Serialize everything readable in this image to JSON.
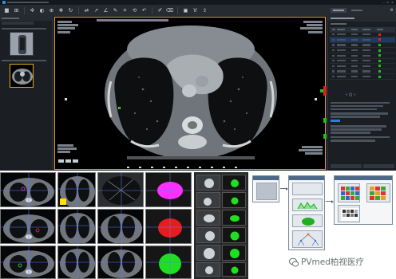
{
  "watermark": {
    "text": "PVmed柏视医疗"
  },
  "icons": {
    "window": [
      "minimize-icon",
      "maximize-icon",
      "close-icon"
    ],
    "toolbar": [
      "layout-icon",
      "grid-icon",
      "adjust-icon",
      "invert-icon",
      "zoom-icon",
      "pan-icon",
      "rotate-icon",
      "flip-icon",
      "measure-icon",
      "angle-icon",
      "annotate-icon",
      "crop-icon",
      "reset-icon",
      "undo-icon",
      "pen-icon",
      "eraser-icon",
      "image-icon",
      "lung-icon",
      "export-icon"
    ],
    "nav": [
      "settings-icon"
    ],
    "results": [
      "previous-icon",
      "play-icon",
      "next-icon"
    ]
  },
  "colors": {
    "accent": "#e0a020",
    "selected_row": "#1e3a60",
    "lesion_red": "#e02020",
    "lesion_green": "#20d020",
    "lesion_magenta": "#ff30ff",
    "nodule_outline": "#58d640"
  }
}
